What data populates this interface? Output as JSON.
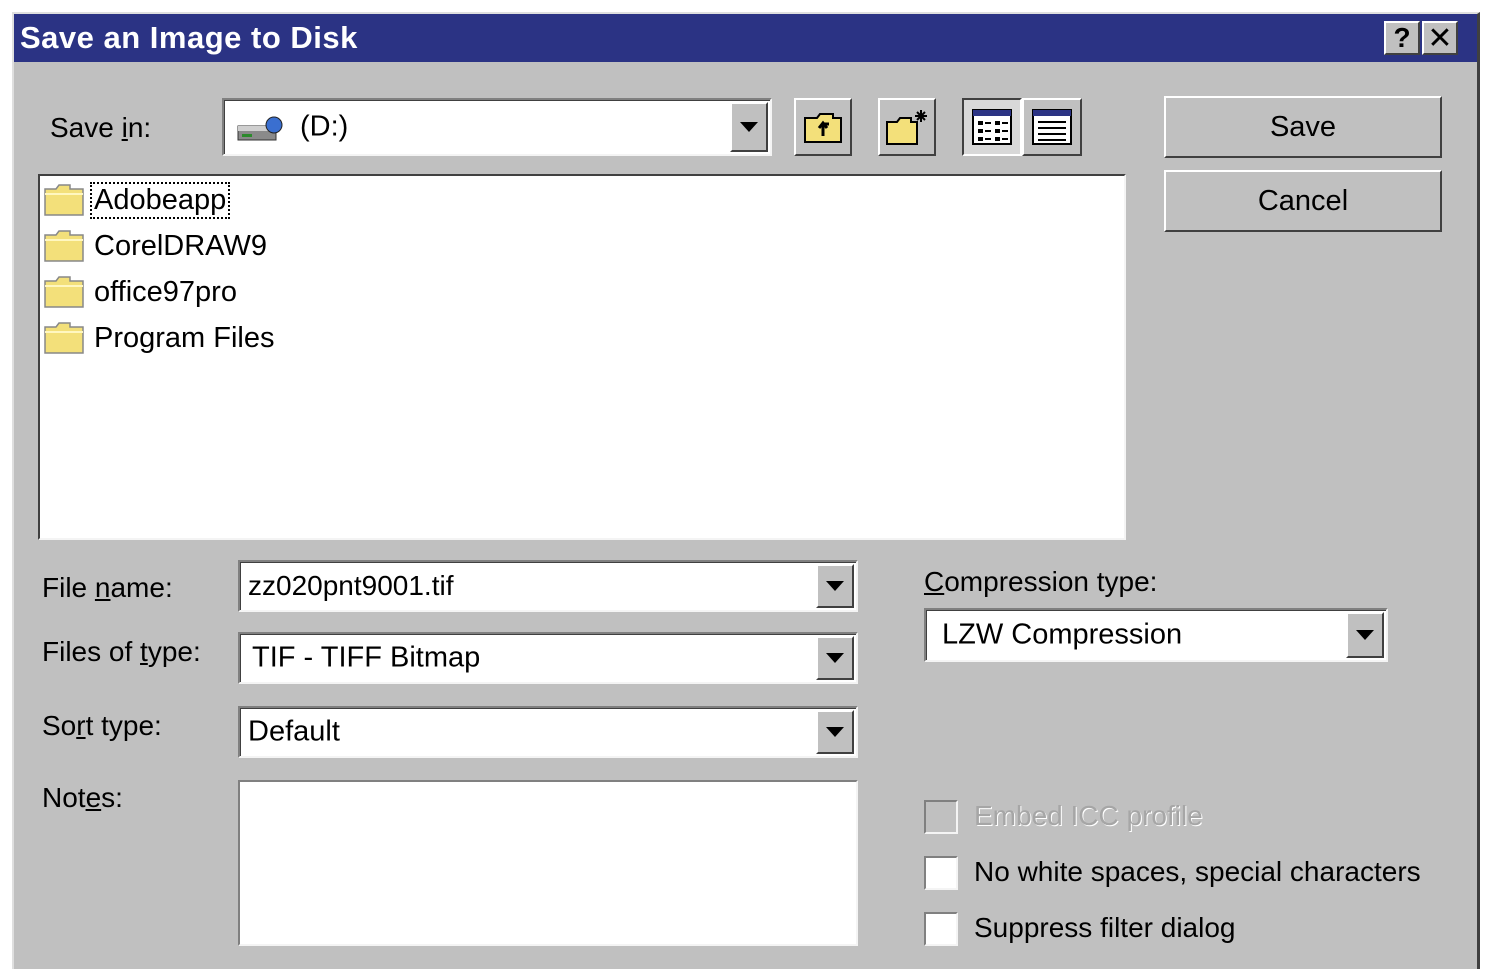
{
  "window": {
    "title": "Save an Image to Disk",
    "help_label": "?",
    "close_label": "✕"
  },
  "save_in": {
    "label": "Save in:",
    "value": "(D:)"
  },
  "toolbar": {
    "icons": [
      "up-one-level-icon",
      "new-folder-icon",
      "list-view-icon",
      "details-view-icon"
    ]
  },
  "buttons": {
    "save": "Save",
    "cancel": "Cancel"
  },
  "files": [
    {
      "name": "Adobeapp"
    },
    {
      "name": "CorelDRAW9"
    },
    {
      "name": "office97pro"
    },
    {
      "name": "Program Files"
    }
  ],
  "file_name": {
    "label": "File name:",
    "value": "zz020pnt9001.tif"
  },
  "files_of_type": {
    "label": "Files of type:",
    "value": "TIF - TIFF Bitmap"
  },
  "sort_type": {
    "label": "Sort type:",
    "value": "Default"
  },
  "notes": {
    "label": "Notes:",
    "value": ""
  },
  "compression": {
    "label": "Compression type:",
    "value": "LZW Compression"
  },
  "options": [
    {
      "label": "Embed ICC profile",
      "checked": false,
      "disabled": true
    },
    {
      "label": "No white spaces, special characters",
      "checked": false,
      "disabled": false
    },
    {
      "label": "Suppress filter dialog",
      "checked": false,
      "disabled": false
    }
  ],
  "colors": {
    "titlebar": "#2b3384",
    "face": "#c0c0c0",
    "folder": "#f3e07a"
  }
}
